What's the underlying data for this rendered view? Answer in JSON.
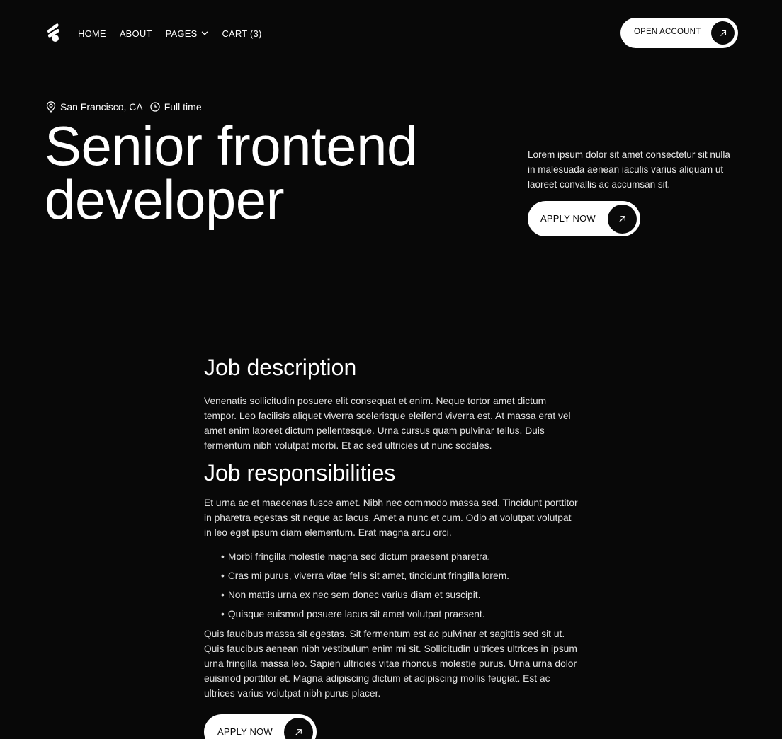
{
  "header": {
    "logo_icon": "logo-icon",
    "nav": {
      "home": "HOME",
      "about": "ABOUT",
      "pages": "PAGES",
      "cart": "CART (3)"
    },
    "open_account": "OPEN ACCOUNT"
  },
  "hero": {
    "location": "San Francisco, CA",
    "employment": "Full time",
    "title_line1": "Senior frontend",
    "title_line2": "developer",
    "intro": "Lorem ipsum dolor sit amet consectetur sit nulla in malesuada aenean iaculis varius aliquam ut laoreet convallis ac accumsan sit.",
    "apply": "APPLY NOW"
  },
  "content": {
    "description_heading": "Job description",
    "description": "Venenatis sollicitudin posuere elit consequat et enim. Neque tortor amet dictum tempor. Leo facilisis aliquet viverra scelerisque eleifend viverra est. At massa erat vel amet enim laoreet dictum pellentesque. Urna cursus quam pulvinar tellus. Duis fermentum nibh volutpat morbi. Et ac sed ultricies ut nunc sodales.",
    "responsibilities_heading": "Job responsibilities",
    "responsibilities_intro": "Et urna ac et maecenas fusce amet. Nibh nec commodo massa sed. Tincidunt porttitor in pharetra egestas sit neque ac lacus. Amet a nunc et cum. Odio at volutpat volutpat in leo eget ipsum diam elementum. Erat magna arcu orci.",
    "bullets": [
      "Morbi fringilla molestie magna sed dictum praesent pharetra.",
      "Cras mi purus, viverra vitae felis sit amet, tincidunt fringilla lorem.",
      "Non mattis urna ex nec sem donec varius diam et suscipit.",
      "Quisque euismod posuere lacus sit amet volutpat praesent."
    ],
    "closing": "Quis faucibus massa sit egestas. Sit fermentum est ac pulvinar et sagittis sed sit ut. Quis faucibus aenean nibh vestibulum enim mi sit. Sollicitudin ultrices ultrices in ipsum urna fringilla massa leo. Sapien ultricies vitae rhoncus molestie purus. Urna urna dolor euismod porttitor et. Magna adipiscing dictum et adipiscing mollis feugiat. Est ac ultrices varius volutpat nibh purus placer.",
    "apply": "APPLY NOW"
  },
  "colors": {
    "background": "#080808",
    "text": "#ffffff",
    "button_bg": "#ffffff",
    "button_circle": "#0a0a0a"
  }
}
